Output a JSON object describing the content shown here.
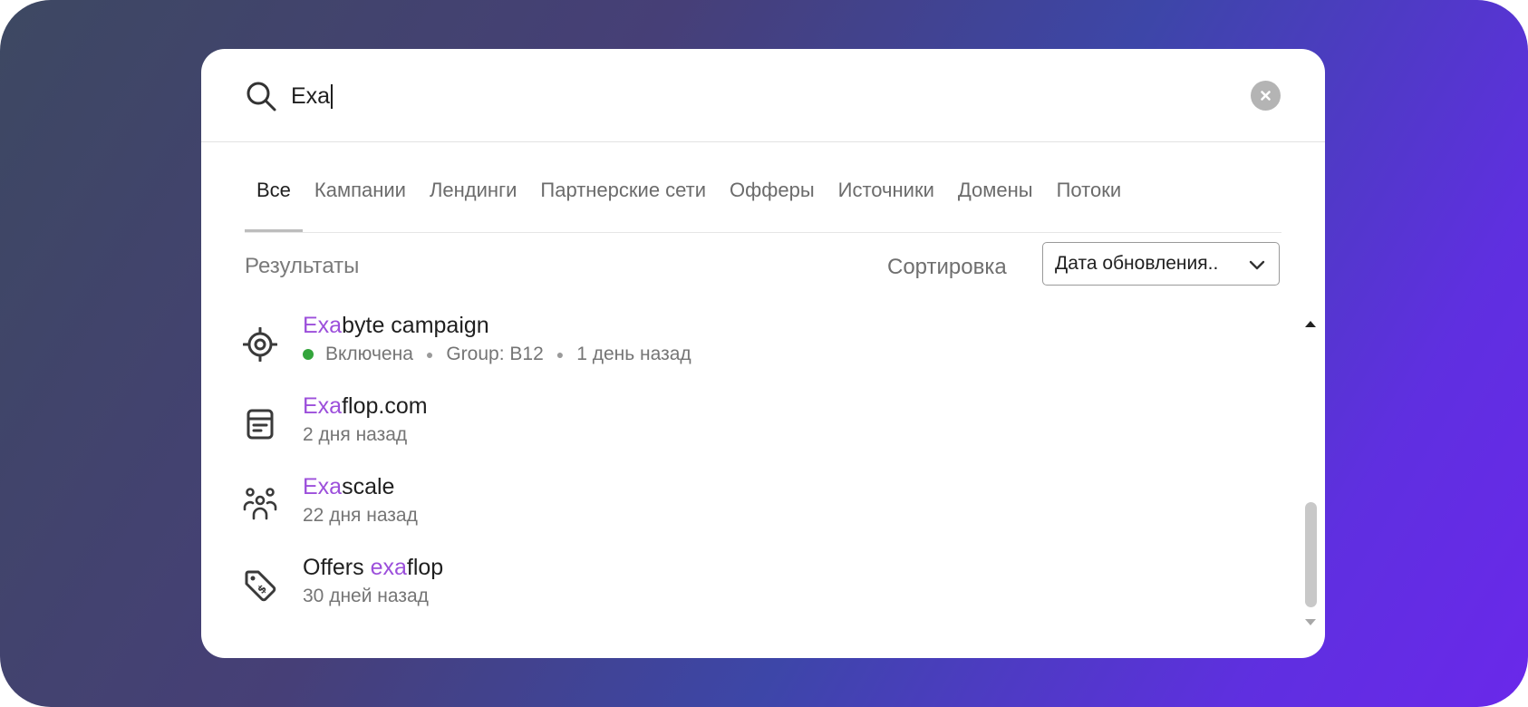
{
  "search": {
    "value": "Exa"
  },
  "tabs": [
    {
      "label": "Все",
      "active": true
    },
    {
      "label": "Кампании",
      "active": false
    },
    {
      "label": "Лендинги",
      "active": false
    },
    {
      "label": "Партнерские сети",
      "active": false
    },
    {
      "label": "Офферы",
      "active": false
    },
    {
      "label": "Источники",
      "active": false
    },
    {
      "label": "Домены",
      "active": false
    },
    {
      "label": "Потоки",
      "active": false
    }
  ],
  "results": {
    "label": "Результаты",
    "sort_label": "Сортировка",
    "sort_value": "Дата обновления.."
  },
  "items": [
    {
      "icon": "target-icon",
      "title_prefix": "",
      "title_match": "Exa",
      "title_rest": "byte campaign",
      "status": "Включена",
      "status_color": "#34a53c",
      "group": "Group: B12",
      "time": "1 день назад"
    },
    {
      "icon": "landing-page-icon",
      "title_prefix": "",
      "title_match": "Exa",
      "title_rest": "flop.com",
      "time": "2 дня назад"
    },
    {
      "icon": "users-group-icon",
      "title_prefix": "",
      "title_match": "Exa",
      "title_rest": "scale",
      "time": "22 дня назад"
    },
    {
      "icon": "offer-tag-icon",
      "title_prefix": "Offers ",
      "title_match": "exa",
      "title_rest": "flop",
      "time": "30 дней назад"
    }
  ],
  "colors": {
    "highlight": "#9c4fdb",
    "status_enabled": "#34a53c"
  }
}
